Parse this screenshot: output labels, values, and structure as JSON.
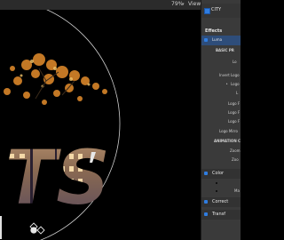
{
  "toolbar": {
    "zoom": "79%",
    "view": "View"
  },
  "inspector": {
    "layer_name": "CITY",
    "section_title": "Effects",
    "effect_name": "Luma",
    "params": [
      "BASIC PR",
      "Lo",
      "Invert Logo",
      "Logo",
      "L",
      "Logo F",
      "Logo F",
      "Logo F",
      "Logo Mirro",
      "ANIMATION C",
      "Zoom",
      "Zoo"
    ],
    "color_label": "Color",
    "ma_label": "Ma",
    "correction_label": "Correct",
    "transform_label": "Transf"
  },
  "canvas": {
    "text": "TS"
  },
  "colors": {
    "accent": "#2f7de1",
    "panel": "#3a3a3a",
    "toolbar": "#2b2b2b",
    "foliage": "#d9862a"
  }
}
